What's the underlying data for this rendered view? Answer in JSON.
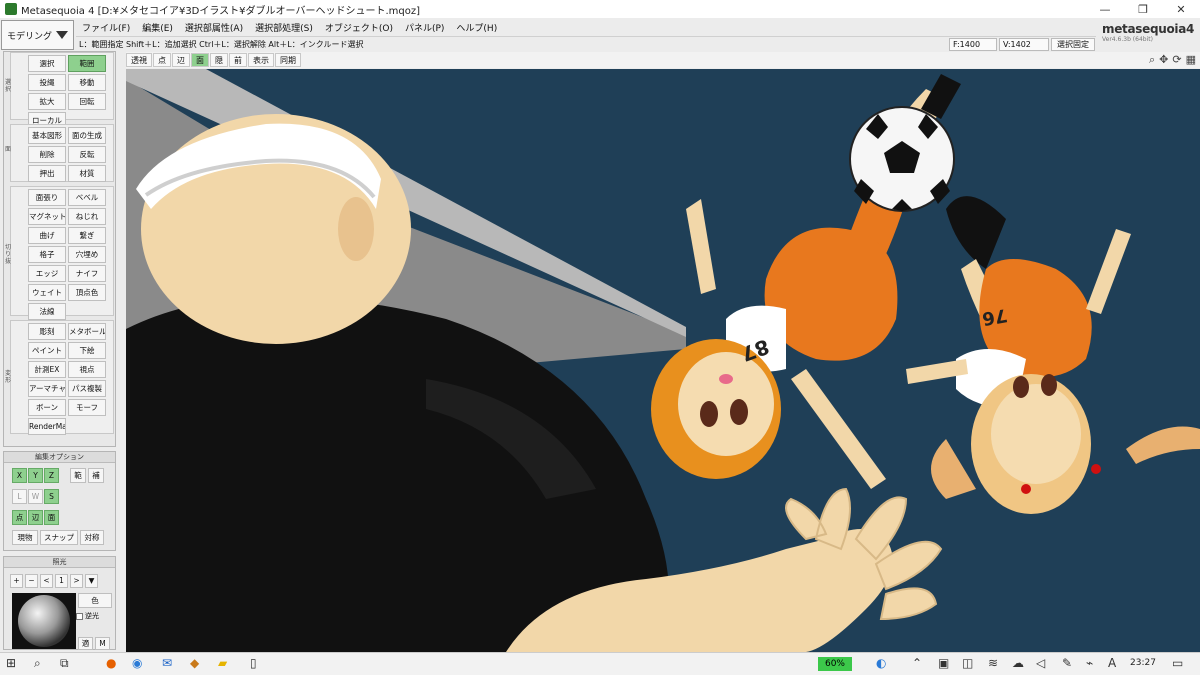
{
  "window": {
    "title": "Metasequoia 4 [D:¥メタセコイア¥3Dイラスト¥ダブルオーバーヘッドシュート.mqoz]",
    "controls": [
      "—",
      "❐",
      "✕"
    ]
  },
  "mode": {
    "label": "モデリング"
  },
  "menu": [
    "ファイル(F)",
    "編集(E)",
    "選択部属性(A)",
    "選択部処理(S)",
    "オブジェクト(O)",
    "パネル(P)",
    "ヘルプ(H)"
  ],
  "logo": {
    "text": "metasequoia4",
    "version": "Ver4.6.3b (64bit)"
  },
  "hint": "L：範囲指定  Shift＋L：追加選択  Ctrl＋L：選択解除  Alt＋L：インクルード選択",
  "counts": {
    "faces": "F:1400",
    "vertices": "V:1402",
    "fix": "選択固定"
  },
  "viewbar": {
    "items": [
      "透視",
      "点",
      "辺",
      "面",
      "隠",
      "前",
      "表示",
      "同期"
    ],
    "active": "面"
  },
  "view_icons": [
    "magnifier-icon",
    "move-icon",
    "rotate-icon",
    "grid-icon"
  ],
  "panel": {
    "groups": [
      {
        "label": "選択",
        "buttons": [
          {
            "text": "選択",
            "key": "",
            "on": false
          },
          {
            "text": "範囲",
            "key": "",
            "on": true
          },
          {
            "text": "投縄",
            "key": "",
            "on": false
          },
          {
            "text": "移動",
            "key": "",
            "on": false
          },
          {
            "text": "拡大",
            "key": "",
            "on": false
          },
          {
            "text": "回転",
            "key": "",
            "on": false
          },
          {
            "text": "ローカル",
            "key": "",
            "on": false
          }
        ]
      },
      {
        "label": "面",
        "buttons": [
          {
            "text": "基本図形",
            "key": "",
            "on": false
          },
          {
            "text": "面の生成",
            "key": "",
            "on": false
          },
          {
            "text": "削除",
            "key": "",
            "on": false
          },
          {
            "text": "反転",
            "key": "",
            "on": false
          },
          {
            "text": "押出",
            "key": "",
            "on": false
          },
          {
            "text": "材質",
            "key": "",
            "on": false
          }
        ]
      },
      {
        "label": "切り抜",
        "buttons": [
          {
            "text": "面張り",
            "key": "",
            "on": false
          },
          {
            "text": "ベベル",
            "key": "",
            "on": false
          },
          {
            "text": "マグネット",
            "key": "",
            "on": false
          },
          {
            "text": "ねじれ",
            "key": "",
            "on": false
          },
          {
            "text": "曲げ",
            "key": "",
            "on": false
          },
          {
            "text": "繋ぎ",
            "key": "",
            "on": false
          },
          {
            "text": "格子",
            "key": "",
            "on": false
          },
          {
            "text": "穴埋め",
            "key": "",
            "on": false
          },
          {
            "text": "エッジ",
            "key": "",
            "on": false
          },
          {
            "text": "ナイフ",
            "key": "",
            "on": false
          },
          {
            "text": "ウェイト",
            "key": "",
            "on": false
          },
          {
            "text": "頂点色",
            "key": "",
            "on": false
          },
          {
            "text": "法線",
            "key": "",
            "on": false
          }
        ]
      },
      {
        "label": "変形",
        "buttons": [
          {
            "text": "彫刻",
            "key": "",
            "on": false
          },
          {
            "text": "メタボール",
            "key": "",
            "on": false
          },
          {
            "text": "ペイント",
            "key": "",
            "on": false
          },
          {
            "text": "下絵",
            "key": "",
            "on": false
          },
          {
            "text": "計測EX",
            "key": "",
            "on": false
          },
          {
            "text": "視点",
            "key": "",
            "on": false
          },
          {
            "text": "アーマチャー",
            "key": "",
            "on": false
          },
          {
            "text": "パス複製",
            "key": "",
            "on": false
          },
          {
            "text": "ボーン",
            "key": "",
            "on": false
          },
          {
            "text": "モーフ",
            "key": "",
            "on": false
          },
          {
            "text": "RenderMan",
            "key": "",
            "on": false
          }
        ]
      }
    ]
  },
  "edit_options": {
    "title": "編集オプション",
    "row1": [
      {
        "t": "X",
        "on": true
      },
      {
        "t": "Y",
        "on": true
      },
      {
        "t": "Z",
        "on": true
      },
      {
        "t": "範",
        "on": false
      },
      {
        "t": "補",
        "on": false
      }
    ],
    "row2": [
      {
        "t": "L",
        "on": false
      },
      {
        "t": "W",
        "on": false
      },
      {
        "t": "S",
        "on": true
      }
    ],
    "row3": [
      {
        "t": "点",
        "on": true
      },
      {
        "t": "辺",
        "on": true
      },
      {
        "t": "面",
        "on": true
      }
    ],
    "row4": [
      {
        "t": "現物",
        "on": false
      },
      {
        "t": "スナップ",
        "on": false
      },
      {
        "t": "対称",
        "on": false
      }
    ]
  },
  "light": {
    "title": "照光",
    "controls": [
      "+",
      "−",
      "<",
      "1",
      ">",
      "▼"
    ],
    "color": "色",
    "reverse": "逆光",
    "bottom": [
      "適",
      "M"
    ]
  },
  "scene": {
    "player1_number": "87",
    "player2_number": "76"
  },
  "taskbar": {
    "battery": "60%",
    "time": "23:27"
  },
  "colors": {
    "viewport_bg": "#1f3f57",
    "active_green": "#8ed08e",
    "jersey_orange": "#e8781e",
    "skin": "#f5dcb0"
  }
}
